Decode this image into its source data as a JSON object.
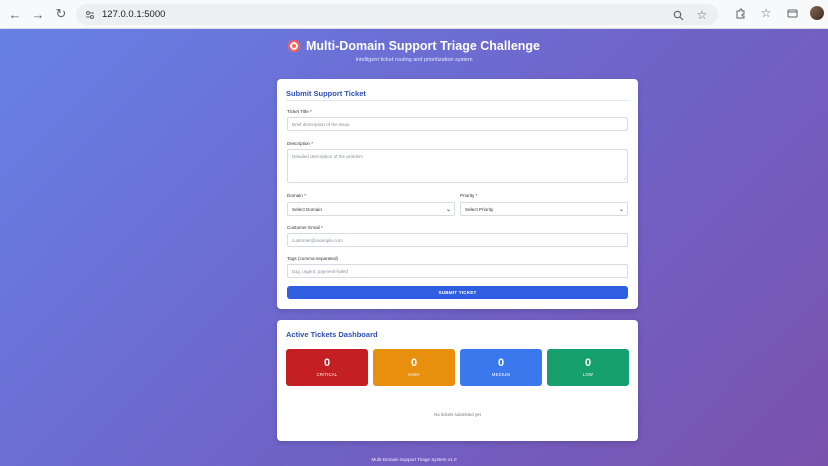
{
  "browser": {
    "url": "127.0.0.1:5000"
  },
  "header": {
    "title": "Multi-Domain Support Triage Challenge",
    "subtitle": "Intelligent ticket routing and prioritization system"
  },
  "form": {
    "card_title": "Submit Support Ticket",
    "title_label": "Ticket Title *",
    "title_placeholder": "Brief description of the issue",
    "description_label": "Description *",
    "description_placeholder": "Detailed description of the problem",
    "domain_label": "Domain *",
    "domain_value": "Select Domain",
    "priority_label": "Priority *",
    "priority_value": "Select Priority",
    "email_label": "Customer Email *",
    "email_placeholder": "customer@example.com",
    "tags_label": "Tags (comma-separated)",
    "tags_placeholder": "bug, urgent, payment-failed",
    "submit_label": "SUBMIT TICKET"
  },
  "dashboard": {
    "card_title": "Active Tickets Dashboard",
    "stats": [
      {
        "count": "0",
        "label": "CRITICAL",
        "color": "#c41f22"
      },
      {
        "count": "0",
        "label": "HIGH",
        "color": "#e8900d"
      },
      {
        "count": "0",
        "label": "MEDIUM",
        "color": "#3a78ee"
      },
      {
        "count": "0",
        "label": "LOW",
        "color": "#16a06e"
      }
    ],
    "empty_text": "No tickets submitted yet"
  },
  "footer": {
    "text": "Multi-Domain Support Triage System v1.0"
  },
  "colors": {
    "accent": "#2f5fe0",
    "heading": "#2f4fb0",
    "background_start": "#6781e6",
    "background_end": "#7a52ad"
  }
}
